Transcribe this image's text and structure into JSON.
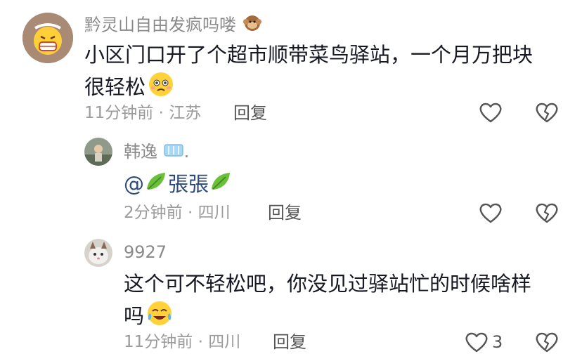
{
  "comments": [
    {
      "user": "黔灵山自由发疯吗喽",
      "text_line1": "小区门口开了个超市顺带菜鸟驿站，一个月万把块",
      "text_line2": "很轻松",
      "time": "11分钟前 · 江苏",
      "reply_label": "回复",
      "icons": [
        "monkey-emoji-icon",
        "woozy-face-emoji-icon"
      ]
    },
    {
      "user": "韩逸",
      "user_suffix": ".",
      "mention_prefix": "@",
      "mention_name": "張張",
      "time": "2分钟前 · 四川",
      "reply_label": "回复",
      "icons": [
        "ice-cube-icon",
        "leaf-icon"
      ]
    },
    {
      "user": "9927",
      "text_line1": "这个可不轻松吧，你没见过驿站忙的时候啥样",
      "text_line2": "吗",
      "time": "11分钟前 · 四川",
      "reply_label": "回复",
      "like_count": "3",
      "icons": [
        "crying-laughing-emoji-icon"
      ]
    }
  ]
}
